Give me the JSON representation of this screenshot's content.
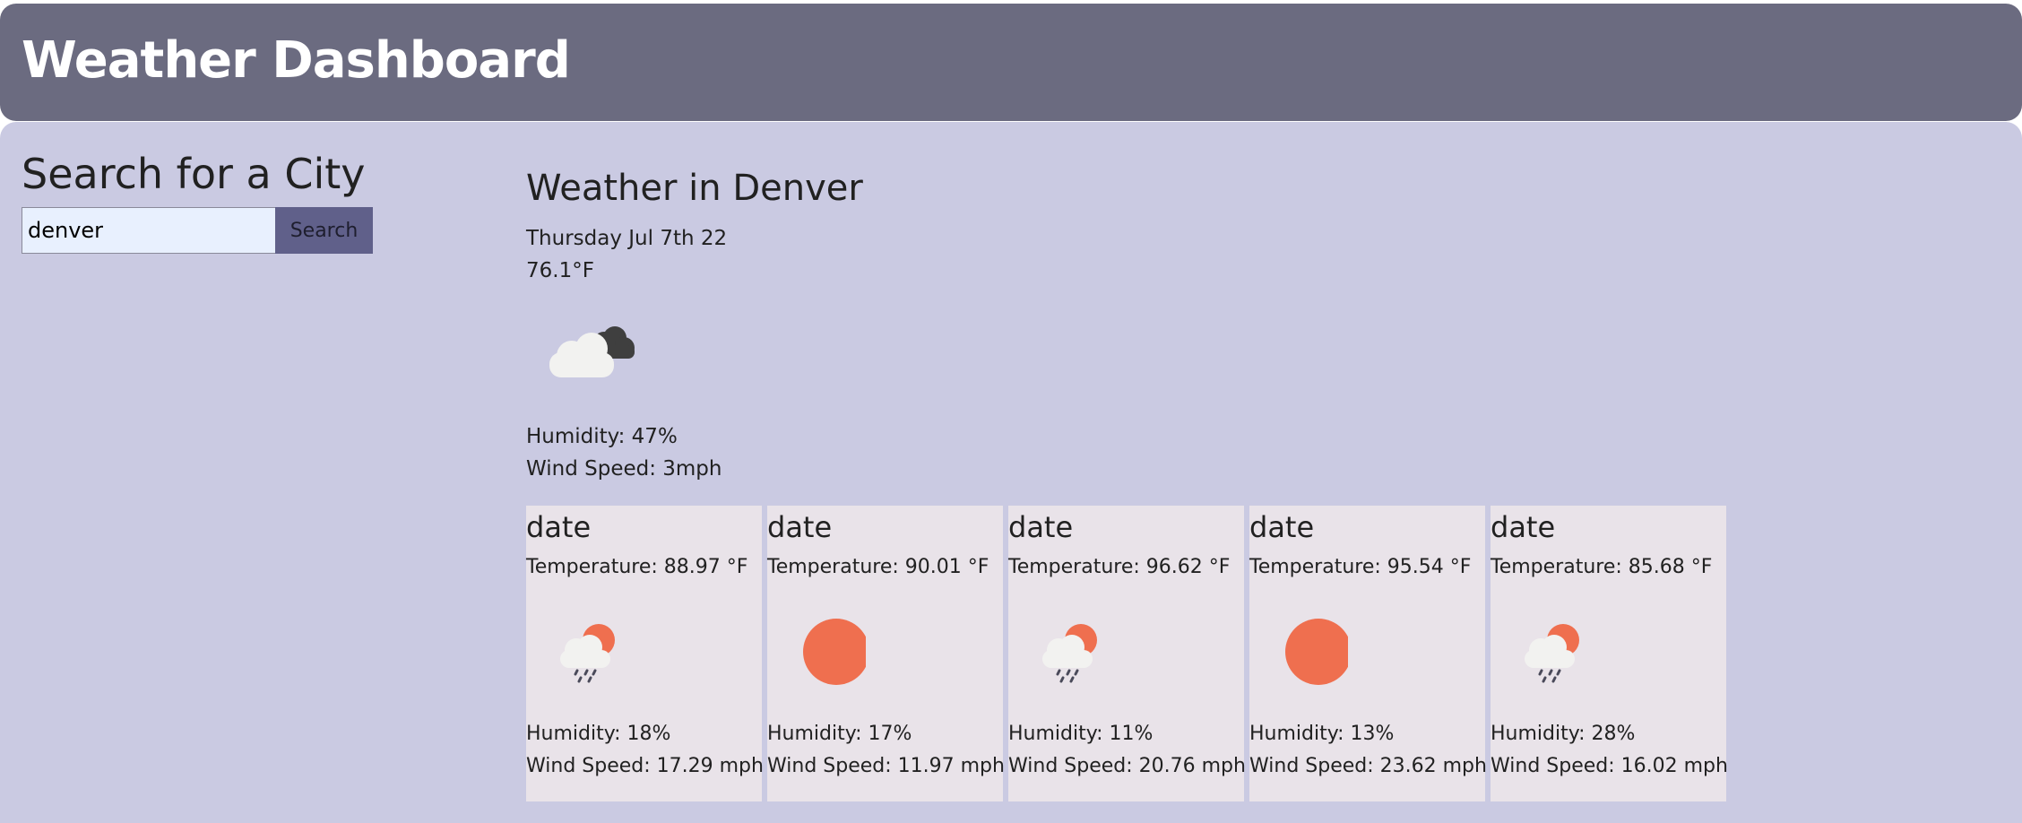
{
  "header": {
    "title": "Weather Dashboard"
  },
  "search": {
    "title": "Search for a City",
    "value": "denver",
    "button_label": "Search"
  },
  "current": {
    "title": "Weather in Denver",
    "date": "Thursday Jul 7th 22",
    "temp": "76.1°F",
    "icon": "partly-cloudy-dark-icon",
    "humidity": "Humidity: 47%",
    "wind": "Wind Speed: 3mph"
  },
  "forecast": [
    {
      "date": "date",
      "temp": "Temperature: 88.97 °F",
      "icon": "sun-rain-cloud-icon",
      "humidity": "Humidity: 18%",
      "wind": "Wind Speed: 17.29 mph"
    },
    {
      "date": "date",
      "temp": "Temperature: 90.01 °F",
      "icon": "sun-icon",
      "humidity": "Humidity: 17%",
      "wind": "Wind Speed: 11.97 mph"
    },
    {
      "date": "date",
      "temp": "Temperature: 96.62 °F",
      "icon": "sun-rain-cloud-icon",
      "humidity": "Humidity: 11%",
      "wind": "Wind Speed: 20.76 mph"
    },
    {
      "date": "date",
      "temp": "Temperature: 95.54 °F",
      "icon": "sun-icon",
      "humidity": "Humidity: 13%",
      "wind": "Wind Speed: 23.62 mph"
    },
    {
      "date": "date",
      "temp": "Temperature: 85.68 °F",
      "icon": "sun-rain-cloud-icon",
      "humidity": "Humidity: 28%",
      "wind": "Wind Speed: 16.02 mph"
    }
  ],
  "colors": {
    "header_bg": "#6b6b80",
    "main_bg": "#cacae2",
    "card_bg": "#e9e3e9",
    "button_bg": "#60608a",
    "sun": "#ef6f4f"
  }
}
